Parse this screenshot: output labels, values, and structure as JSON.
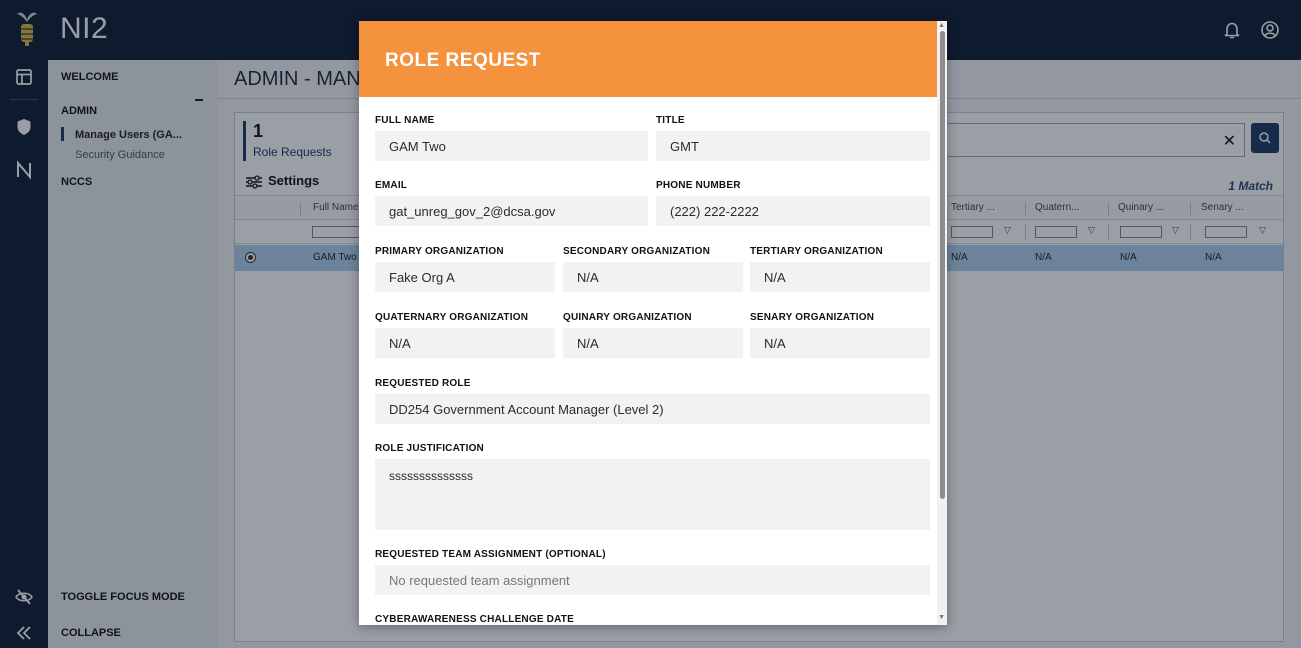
{
  "app": {
    "title": "NI2"
  },
  "topbar": {
    "icons": [
      "bell-icon",
      "user-circle-icon"
    ]
  },
  "rail": {
    "top_icons": [
      "dashboard-icon",
      "shield-icon",
      "n-icon"
    ],
    "bottom_icons": [
      "eye-slash-icon",
      "double-chevron-left-icon"
    ]
  },
  "nav": {
    "welcome": "WELCOME",
    "admin": "ADMIN",
    "admin_items": [
      {
        "label": "Manage Users (GA..."
      },
      {
        "label": "Security Guidance"
      }
    ],
    "nccs": "NCCS",
    "toggle_focus": "TOGGLE FOCUS MODE",
    "collapse": "COLLAPSE"
  },
  "main": {
    "page_title": "ADMIN - MAN",
    "stat": {
      "count": "1",
      "label": "Role Requests"
    },
    "settings_label": "Settings",
    "match_label": "1 Match",
    "columns": [
      "Full Name",
      "Tertiary ...",
      "Quatern...",
      "Quinary ...",
      "Senary ..."
    ],
    "row": {
      "full_name": "GAM Two",
      "tertiary": "N/A",
      "quaternary": "N/A",
      "quinary": "N/A",
      "senary": "N/A"
    }
  },
  "modal": {
    "title": "ROLE REQUEST",
    "fields": {
      "full_name": {
        "label": "FULL NAME",
        "value": "GAM Two"
      },
      "title": {
        "label": "TITLE",
        "value": "GMT"
      },
      "email": {
        "label": "EMAIL",
        "value": "gat_unreg_gov_2@dcsa.gov"
      },
      "phone": {
        "label": "PHONE NUMBER",
        "value": "(222) 222-2222"
      },
      "primary_org": {
        "label": "PRIMARY ORGANIZATION",
        "value": "Fake Org A"
      },
      "secondary_org": {
        "label": "SECONDARY ORGANIZATION",
        "value": "N/A"
      },
      "tertiary_org": {
        "label": "TERTIARY ORGANIZATION",
        "value": "N/A"
      },
      "quaternary_org": {
        "label": "QUATERNARY ORGANIZATION",
        "value": "N/A"
      },
      "quinary_org": {
        "label": "QUINARY ORGANIZATION",
        "value": "N/A"
      },
      "senary_org": {
        "label": "SENARY ORGANIZATION",
        "value": "N/A"
      },
      "requested_role": {
        "label": "REQUESTED ROLE",
        "value": "DD254 Government Account Manager (Level 2)"
      },
      "justification": {
        "label": "ROLE JUSTIFICATION",
        "value": "ssssssssssssss"
      },
      "team_assignment": {
        "label": "REQUESTED TEAM ASSIGNMENT (OPTIONAL)",
        "value": "No requested team assignment"
      },
      "cyber_date": {
        "label": "CYBERAWARENESS CHALLENGE DATE"
      }
    }
  },
  "colors": {
    "modal_header": "#f5923e",
    "topbar": "#0f1d33",
    "selected_row": "#aed2ee",
    "accent": "#1d3b63"
  }
}
